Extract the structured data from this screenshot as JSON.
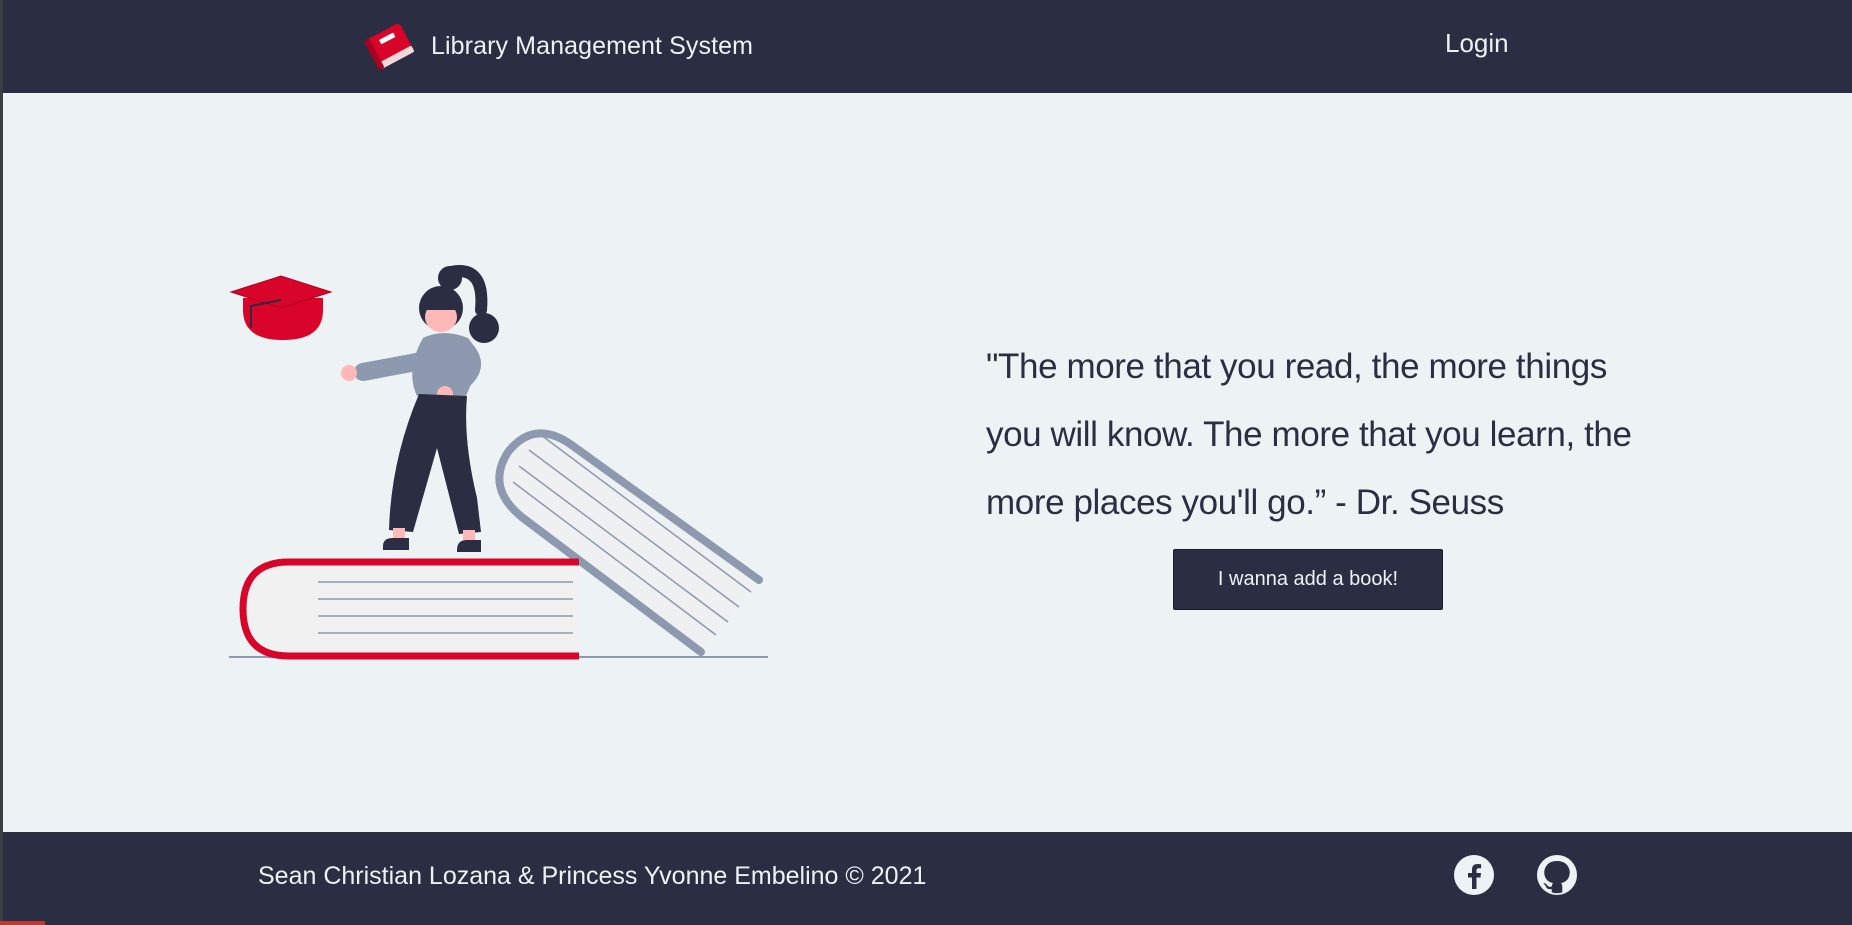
{
  "header": {
    "brand_label": "Library Management System",
    "brand_icon": "red-book-icon",
    "login_label": "Login"
  },
  "main": {
    "quote": "\"The more that you read, the more things you will know. The more that you learn, the more places you'll go.” - Dr. Seuss",
    "add_book_label": "I wanna add a book!"
  },
  "footer": {
    "credits": "Sean Christian Lozana & Princess Yvonne Embelino © 2021",
    "social_icons": [
      "facebook-icon",
      "github-icon"
    ]
  },
  "colors": {
    "navy": "#2b2d42",
    "background": "#edf2f4",
    "accent_red": "#d90429",
    "muted_blue": "#8d99ae"
  }
}
